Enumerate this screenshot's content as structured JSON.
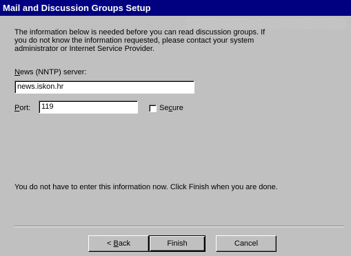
{
  "window": {
    "title": "Mail and Discussion Groups Setup"
  },
  "info": {
    "line1": "The information below is needed before you can read discussion groups.  If",
    "line2": "you do not know the information requested, please contact your system",
    "line3": "administrator or Internet Service Provider."
  },
  "server": {
    "label_mnemonic": "N",
    "label_rest": "ews (NNTP) server:",
    "value": "news.iskon.hr"
  },
  "port": {
    "label_mnemonic": "P",
    "label_rest": "ort:",
    "value": "119"
  },
  "secure": {
    "label_pre": "Se",
    "label_mnemonic": "c",
    "label_post": "ure",
    "checked": false
  },
  "note": "You do not have to enter this information now. Click Finish when you are done.",
  "buttons": {
    "back_prefix": "< ",
    "back_mnemonic": "B",
    "back_rest": "ack",
    "finish": "Finish",
    "cancel": "Cancel"
  }
}
